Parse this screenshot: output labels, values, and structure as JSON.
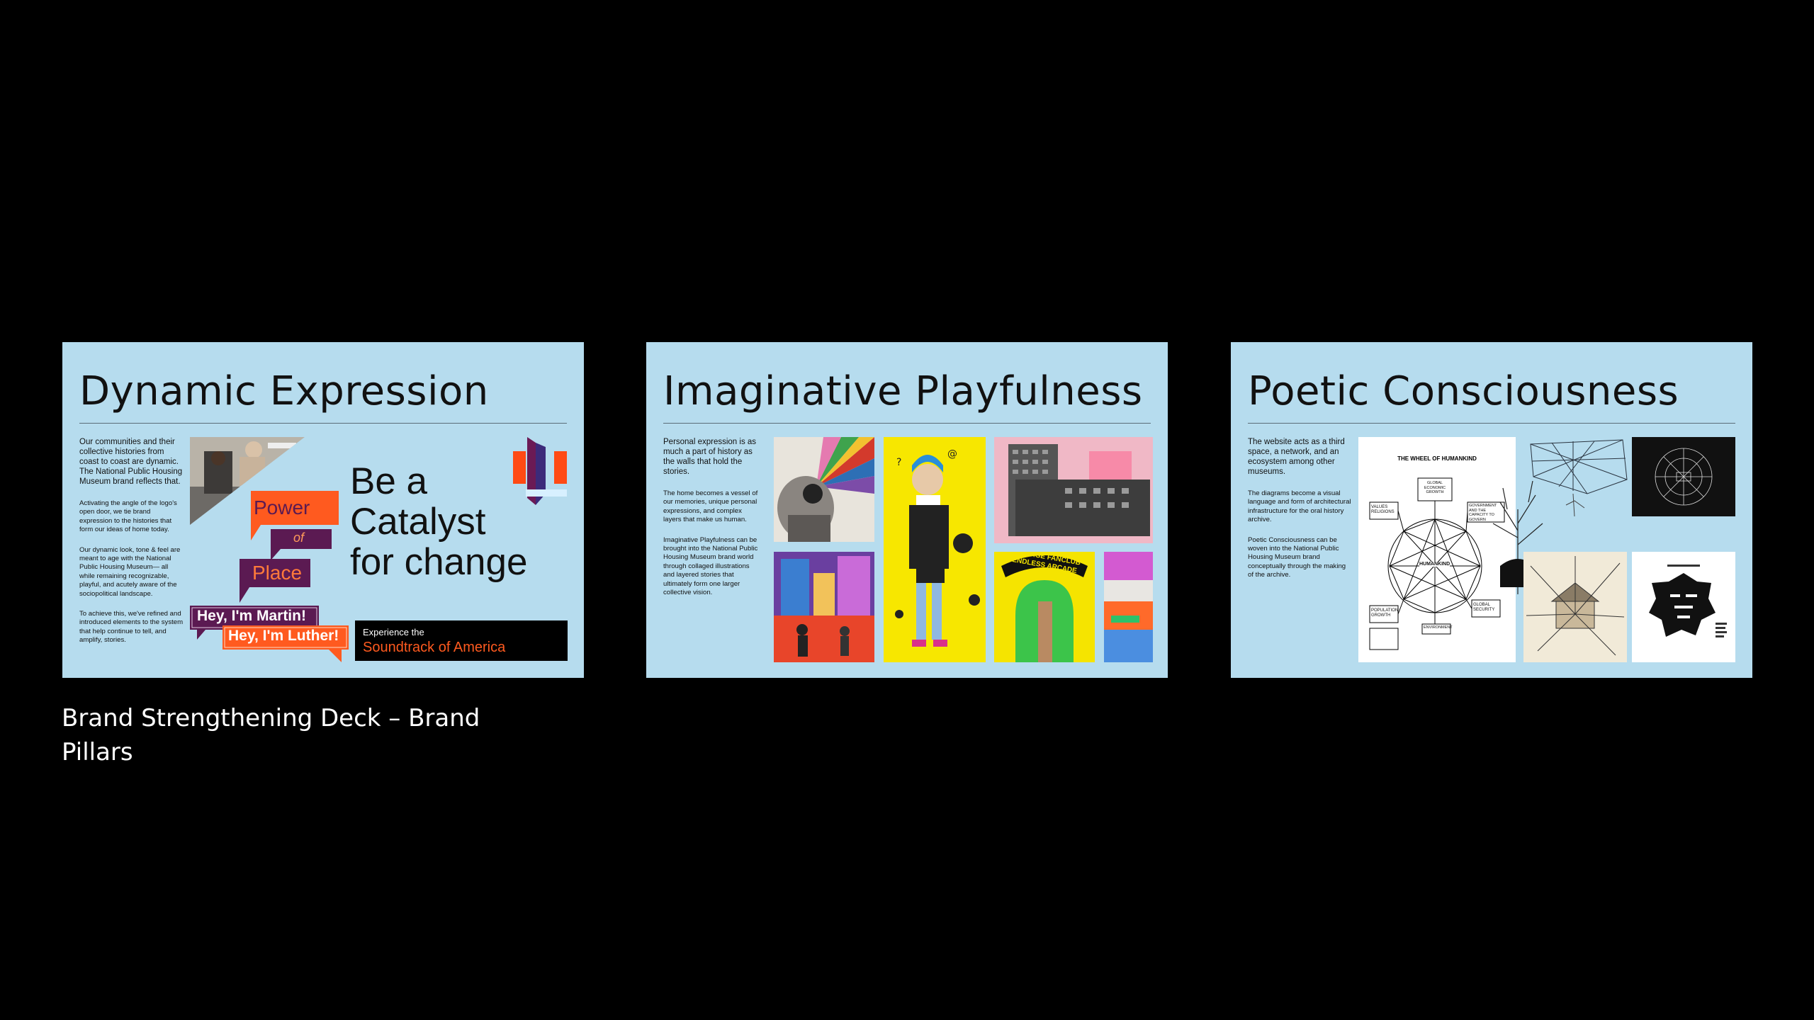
{
  "slides": [
    {
      "title": "Dynamic Expression",
      "body": [
        "Our communities and their collective histories from coast to coast are dynamic. The National Public Housing Museum brand reflects that.",
        "Activating the angle of the logo's open door, we tie brand expression to the histories that form our ideas of home today.",
        "Our dynamic look, tone & feel are meant to age with the National Public Housing Museum— all while remaining recognizable, playful, and acutely aware of the sociopolitical landscape.",
        "To achieve this, we've refined and introduced elements to the system that help continue to tell, and amplify, stories."
      ],
      "headline": [
        "Be a",
        "Catalyst",
        "for change"
      ],
      "power": {
        "word1": "Power",
        "word2": "of",
        "word3": "Place"
      },
      "bubbles": [
        "Hey, I'm Martin!",
        "Hey, I'm Luther!"
      ],
      "experience": {
        "line1": "Experience the",
        "line2": "Soundtrack of America"
      }
    },
    {
      "title": "Imaginative Playfulness",
      "body": [
        "Personal expression is as much a part of history as the walls that hold the stories.",
        "The home becomes a vessel of our memories, unique personal expressions, and complex layers that make us human.",
        "Imaginative Playfulness can be brought into the National Public Housing Museum brand world through collaged illustrations and layered stories that ultimately form one larger collective vision."
      ],
      "arcade_line1": "TEENAGE FANCLUB",
      "arcade_line2": "ENDLESS ARCADE"
    },
    {
      "title": "Poetic Consciousness",
      "body": [
        "The website acts as a third space, a network, and an ecosystem among other museums.",
        "The diagrams become a visual language and form of architectural infrastructure for the oral history archive.",
        "Poetic Consciousness can be woven into the National Public Housing Museum brand conceptually through the making of the archive."
      ],
      "wheel": {
        "title": "THE WHEEL OF HUMANKIND",
        "center": "HUMANKIND",
        "labels": [
          "VALUES RELIGIONS",
          "GOVERNMENT AND THE CAPACITY TO GOVERN",
          "POPULATION GROWTH",
          "GLOBAL SECURITY",
          "ENVIRONMENT",
          "GLOBAL ECONOMIC GROWTH"
        ]
      }
    }
  ],
  "caption": "Brand Strengthening Deck – Brand Pillars",
  "colors": {
    "background": "#000000",
    "slide": "#b6dcee",
    "orange": "#ff5a1f",
    "purple": "#5b1a52"
  }
}
